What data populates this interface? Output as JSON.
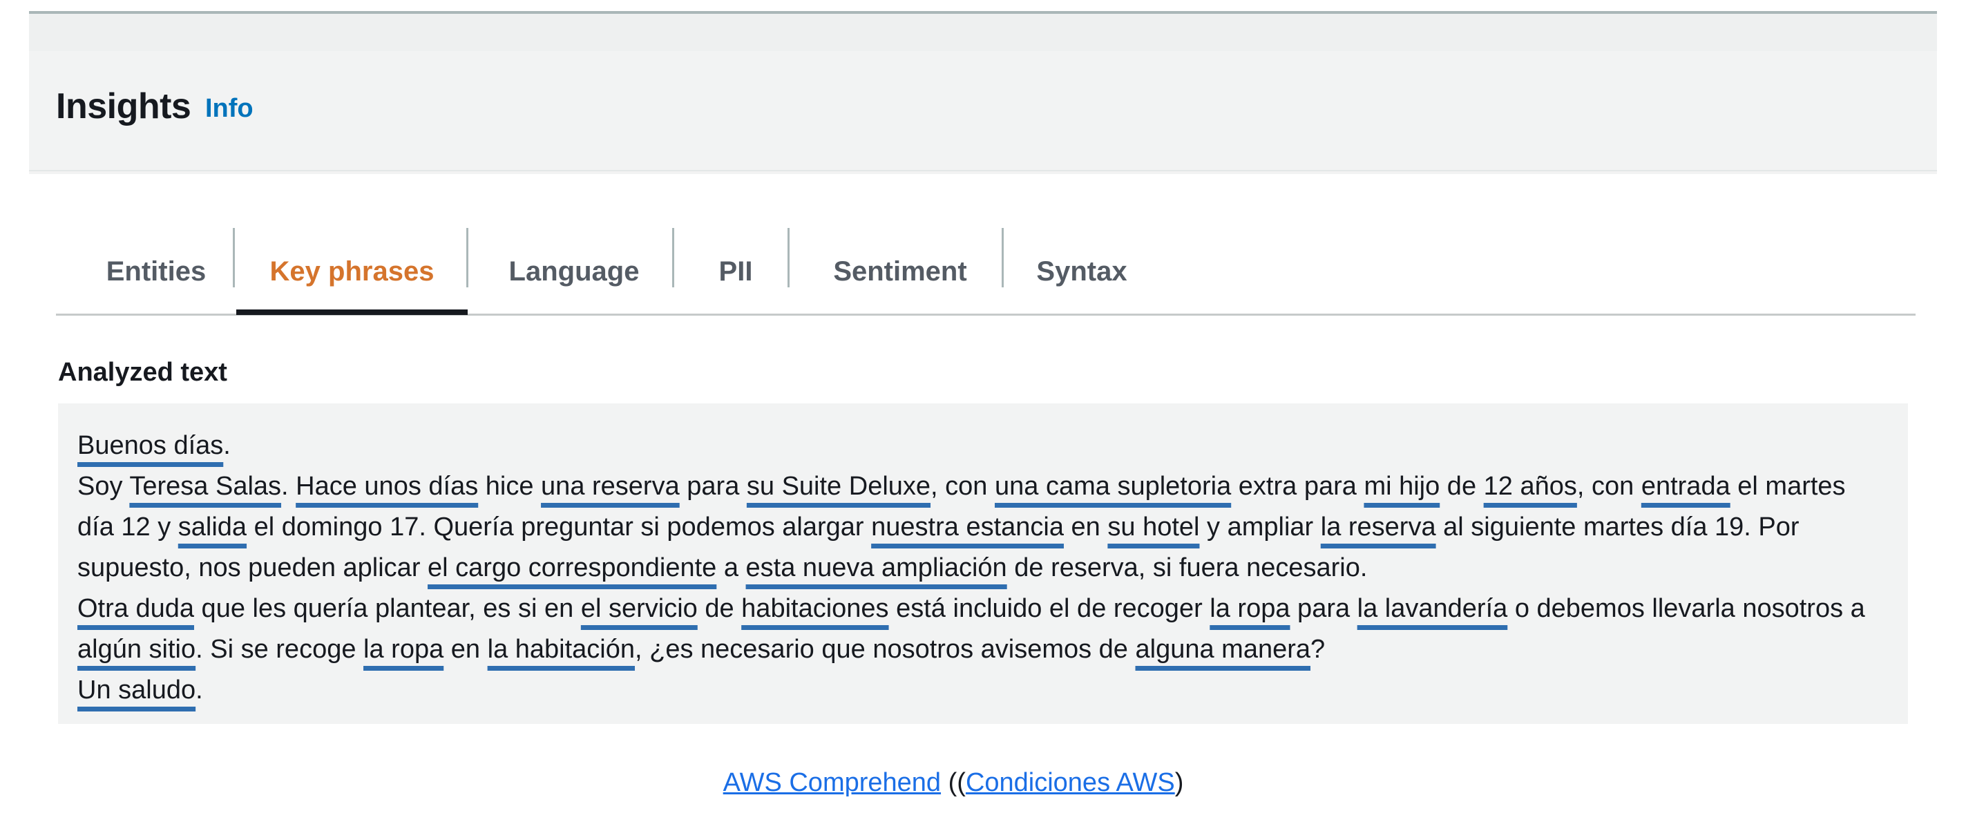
{
  "header": {
    "title": "Insights",
    "info_link": "Info"
  },
  "tabs": [
    {
      "label": "Entities",
      "active": false
    },
    {
      "label": "Key phrases",
      "active": true
    },
    {
      "label": "Language",
      "active": false
    },
    {
      "label": "PII",
      "active": false
    },
    {
      "label": "Sentiment",
      "active": false
    },
    {
      "label": "Syntax",
      "active": false
    }
  ],
  "analyzed": {
    "label": "Analyzed text",
    "paragraphs": [
      [
        {
          "t": "Buenos días",
          "kp": true
        },
        {
          "t": ".",
          "kp": false
        }
      ],
      [
        {
          "t": "Soy ",
          "kp": false
        },
        {
          "t": "Teresa Salas",
          "kp": true
        },
        {
          "t": ". ",
          "kp": false
        },
        {
          "t": "Hace unos días",
          "kp": true
        },
        {
          "t": " hice ",
          "kp": false
        },
        {
          "t": "una reserva",
          "kp": true
        },
        {
          "t": " para ",
          "kp": false
        },
        {
          "t": "su Suite Deluxe",
          "kp": true
        },
        {
          "t": ", con ",
          "kp": false
        },
        {
          "t": "una cama supletoria",
          "kp": true
        },
        {
          "t": " extra para ",
          "kp": false
        },
        {
          "t": "mi hijo",
          "kp": true
        },
        {
          "t": " de ",
          "kp": false
        },
        {
          "t": "12 años",
          "kp": true
        },
        {
          "t": ", con ",
          "kp": false
        },
        {
          "t": "entrada",
          "kp": true
        },
        {
          "t": " el martes día 12 y ",
          "kp": false
        },
        {
          "t": "salida",
          "kp": true
        },
        {
          "t": " el domingo 17. Quería preguntar si podemos alargar ",
          "kp": false
        },
        {
          "t": "nuestra estancia",
          "kp": true
        },
        {
          "t": " en ",
          "kp": false
        },
        {
          "t": "su hotel",
          "kp": true
        },
        {
          "t": " y ampliar ",
          "kp": false
        },
        {
          "t": "la reserva",
          "kp": true
        },
        {
          "t": " al siguiente martes día 19. Por supuesto, nos pueden aplicar ",
          "kp": false
        },
        {
          "t": "el cargo correspondiente",
          "kp": true
        },
        {
          "t": " a ",
          "kp": false
        },
        {
          "t": "esta nueva ampliación",
          "kp": true
        },
        {
          "t": " de reserva, si fuera necesario.",
          "kp": false
        }
      ],
      [
        {
          "t": "Otra duda",
          "kp": true
        },
        {
          "t": " que les quería plantear, es si en ",
          "kp": false
        },
        {
          "t": "el servicio",
          "kp": true
        },
        {
          "t": " de ",
          "kp": false
        },
        {
          "t": "habitaciones",
          "kp": true
        },
        {
          "t": " está incluido el de recoger ",
          "kp": false
        },
        {
          "t": "la ropa",
          "kp": true
        },
        {
          "t": " para ",
          "kp": false
        },
        {
          "t": "la lavandería",
          "kp": true
        },
        {
          "t": " o debemos llevarla nosotros a ",
          "kp": false
        },
        {
          "t": "algún sitio",
          "kp": true
        },
        {
          "t": ". Si se recoge ",
          "kp": false
        },
        {
          "t": "la ropa",
          "kp": true
        },
        {
          "t": " en ",
          "kp": false
        },
        {
          "t": "la habitación",
          "kp": true
        },
        {
          "t": ", ¿es necesario que nosotros avisemos de ",
          "kp": false
        },
        {
          "t": "alguna manera",
          "kp": true
        },
        {
          "t": "?",
          "kp": false
        }
      ],
      [
        {
          "t": "Un saludo",
          "kp": true
        },
        {
          "t": ".",
          "kp": false
        }
      ]
    ]
  },
  "footer": {
    "link1": "AWS Comprehend",
    "open": " ((",
    "link2": "Condiciones AWS",
    "close": ")"
  },
  "colors": {
    "accent_active_tab": "#d5742c",
    "key_phrase_underline": "#2f6eb0",
    "info_link": "#0073bb"
  }
}
